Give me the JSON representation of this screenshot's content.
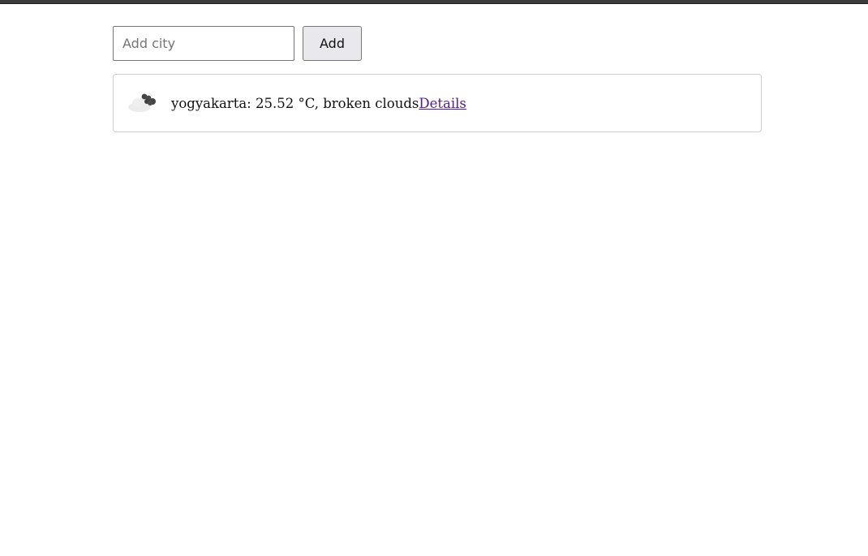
{
  "form": {
    "city_input_value": "",
    "city_input_placeholder": "Add city",
    "add_label": "Add"
  },
  "weather": {
    "items": [
      {
        "icon": "broken-clouds-icon",
        "text": "yogyakarta: 25.52 °C, broken clouds",
        "details_label": "Details"
      }
    ]
  },
  "colors": {
    "link_visited": "#551a8b",
    "button_bg": "#e9e9ed",
    "card_border": "#cfcfcf"
  }
}
